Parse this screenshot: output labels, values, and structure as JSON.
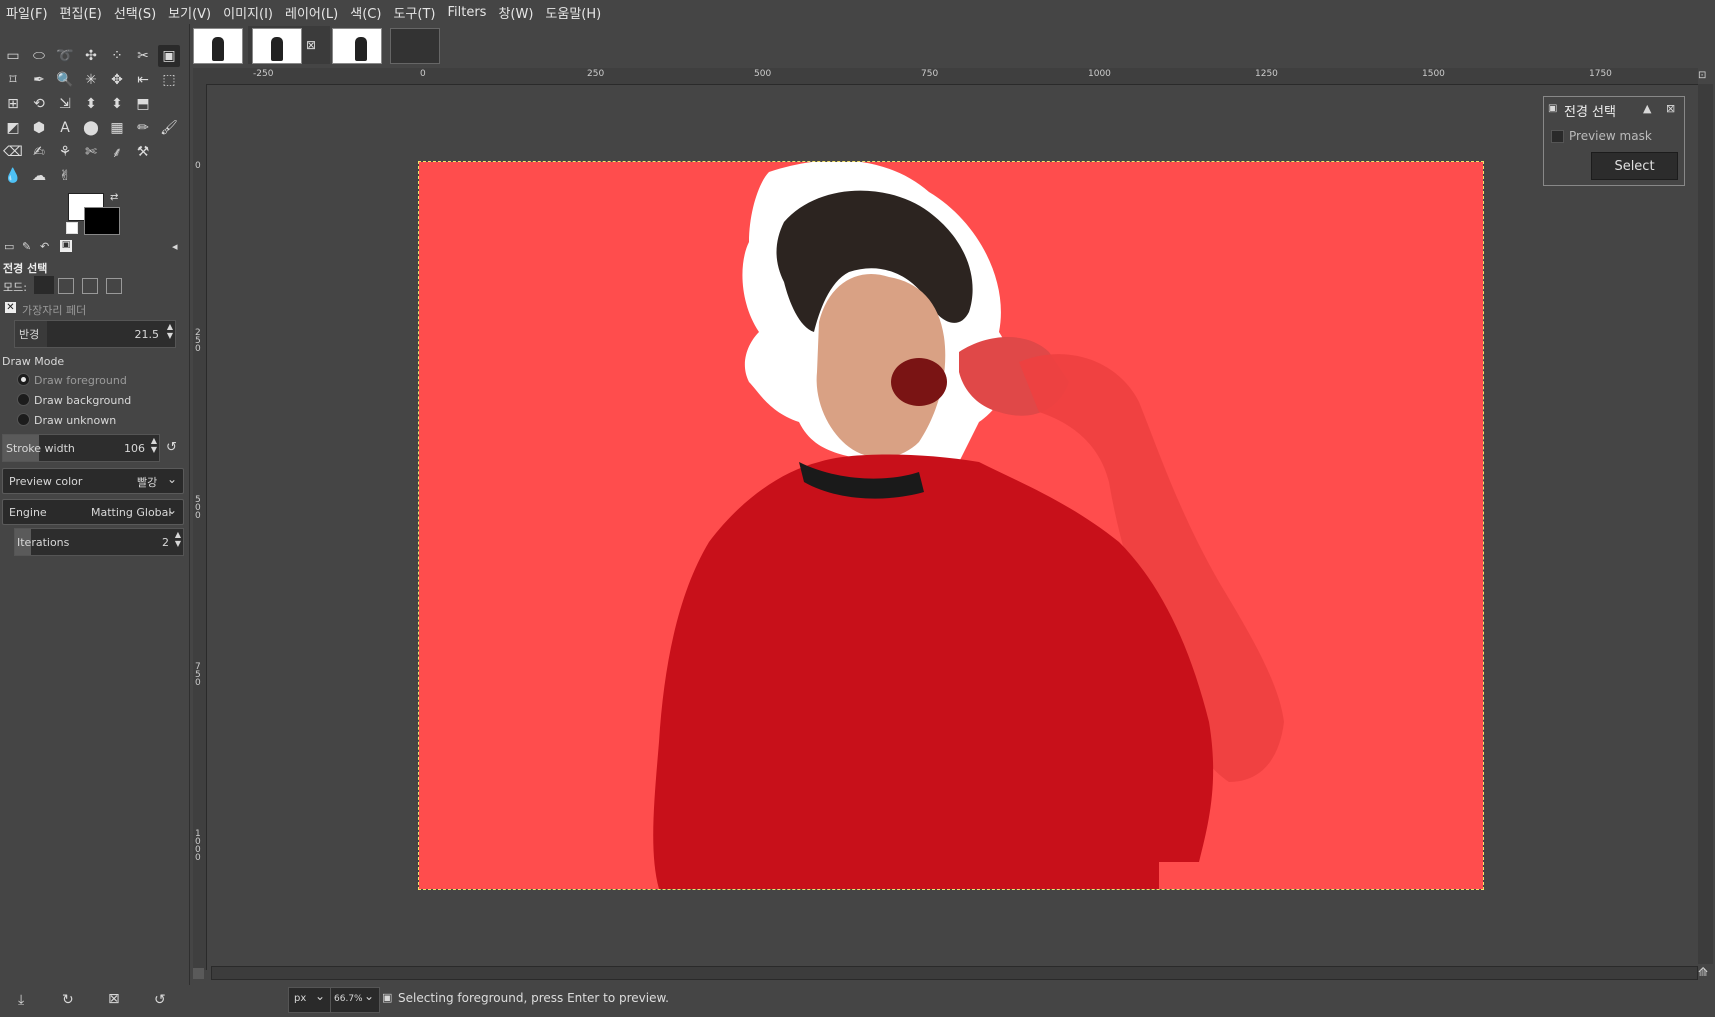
{
  "menu": [
    "파일(F)",
    "편집(E)",
    "선택(S)",
    "보기(V)",
    "이미지(I)",
    "레이어(L)",
    "색(C)",
    "도구(T)",
    "Filters",
    "창(W)",
    "도움말(H)"
  ],
  "tool_options": {
    "title": "전경 선택",
    "mode_label": "모드:",
    "feather_label": "가장자리 페더",
    "radius_label": "반경",
    "radius_value": "21.5",
    "draw_mode_label": "Draw Mode",
    "draw_options": [
      "Draw foreground",
      "Draw background",
      "Draw unknown"
    ],
    "selected_draw_option": "Draw foreground",
    "stroke_width_label": "Stroke width",
    "stroke_width_value": "106",
    "preview_color_label": "Preview color",
    "preview_color_value": "빨강",
    "engine_label": "Engine",
    "engine_value": "Matting Global",
    "iterations_label": "Iterations",
    "iterations_value": "2"
  },
  "ruler": {
    "h_labels": [
      "-250",
      "0",
      "250",
      "500",
      "750",
      "1000",
      "1250",
      "1500",
      "1750"
    ],
    "v_labels": [
      "0",
      "250",
      "500",
      "750",
      "1000"
    ]
  },
  "dialog": {
    "title": "전경 선택",
    "preview_mask_label": "Preview mask",
    "select_label": "Select"
  },
  "status": {
    "unit": "px",
    "zoom": "66.7%",
    "message": "Selecting foreground, press Enter to preview."
  },
  "colors": {
    "overlay_red": "#ff4d4d",
    "foreground_red": "#c8101a",
    "fg_color": "#ffffff",
    "bg_color": "#000000"
  }
}
